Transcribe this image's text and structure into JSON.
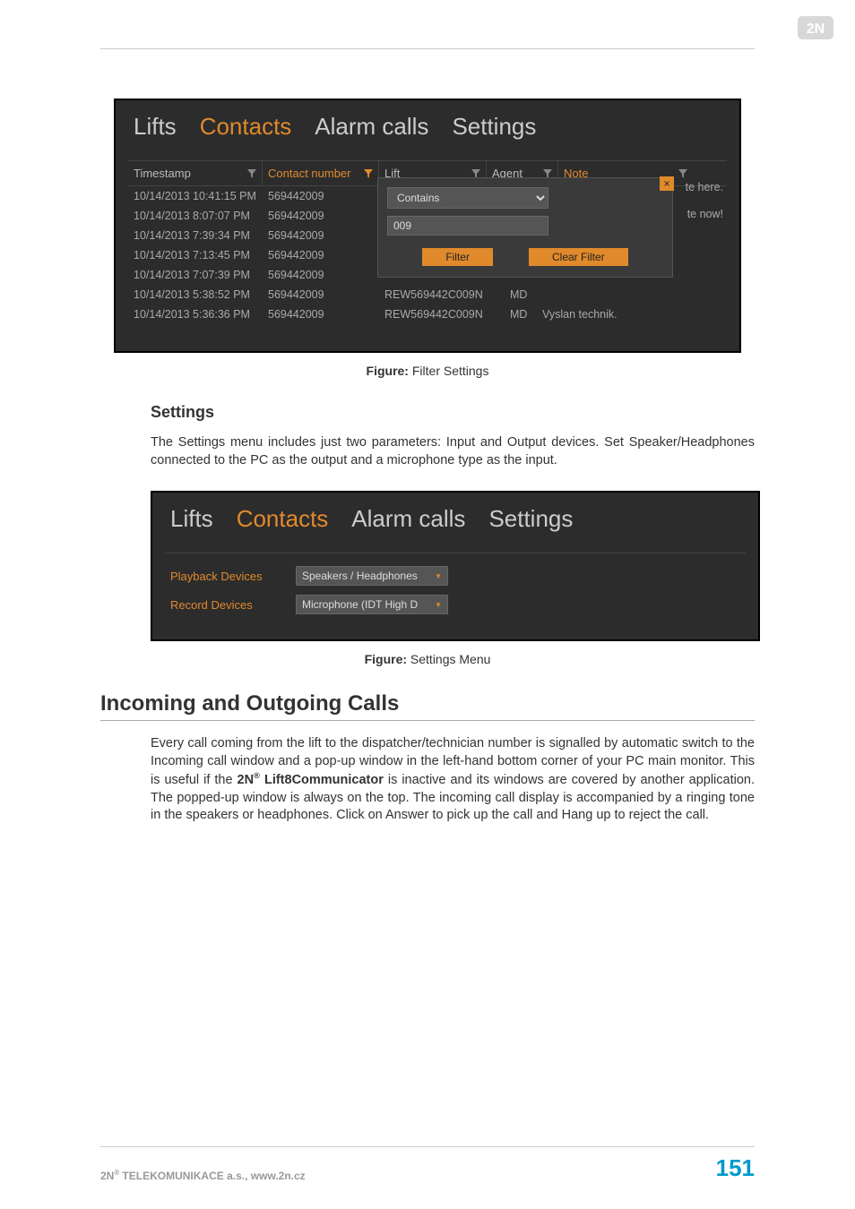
{
  "logo_text": "2N",
  "shot1": {
    "tabs": [
      "Lifts",
      "Contacts",
      "Alarm calls",
      "Settings"
    ],
    "active_tab_index": 1,
    "columns": {
      "timestamp": "Timestamp",
      "contact_number": "Contact number",
      "lift": "Lift",
      "agent": "Agent",
      "note": "Note"
    },
    "rows": [
      {
        "ts": "10/14/2013 10:41:15 PM",
        "cn": "569442009",
        "lift": "",
        "agent": "",
        "note": ""
      },
      {
        "ts": "10/14/2013 8:07:07 PM",
        "cn": "569442009",
        "lift": "",
        "agent": "",
        "note": ""
      },
      {
        "ts": "10/14/2013 7:39:34 PM",
        "cn": "569442009",
        "lift": "",
        "agent": "",
        "note": ""
      },
      {
        "ts": "10/14/2013 7:13:45 PM",
        "cn": "569442009",
        "lift": "",
        "agent": "",
        "note": ""
      },
      {
        "ts": "10/14/2013 7:07:39 PM",
        "cn": "569442009",
        "lift": "",
        "agent": "",
        "note": ""
      },
      {
        "ts": "10/14/2013 5:38:52 PM",
        "cn": "569442009",
        "lift": "REW569442C009N",
        "agent": "MD",
        "note": ""
      },
      {
        "ts": "10/14/2013 5:36:36 PM",
        "cn": "569442009",
        "lift": "REW569442C009N",
        "agent": "MD",
        "note": "Vyslan technik."
      }
    ],
    "popup": {
      "operator": "Contains",
      "value": "009",
      "filter_btn": "Filter",
      "clear_btn": "Clear Filter",
      "close": "×"
    },
    "note_peek1": "te here.",
    "note_peek2": "te now!"
  },
  "caption1_label": "Figure:",
  "caption1_text": "Filter Settings",
  "settings_heading": "Settings",
  "settings_para": "The Settings menu includes just two parameters: Input and Output devices. Set Speaker/Headphones connected to the PC as the output and a microphone type as the input.",
  "shot2": {
    "tabs": [
      "Lifts",
      "Contacts",
      "Alarm calls",
      "Settings"
    ],
    "active_tab_index": 1,
    "rows": [
      {
        "label": "Playback Devices",
        "value": "Speakers / Headphones"
      },
      {
        "label": "Record Devices",
        "value": "Microphone (IDT High D"
      }
    ]
  },
  "caption2_label": "Figure:",
  "caption2_text": "Settings Menu",
  "h2": "Incoming and Outgoing Calls",
  "para2_a": "Every call coming from the lift to the dispatcher/technician number is signalled by automatic switch to the Incoming call window and a pop-up window in the left-hand bottom corner of your PC main monitor. This is useful if the ",
  "para2_bold_pre": "2N",
  "para2_bold_sup": "®",
  "para2_bold_post": " Lift8Communicator",
  "para2_b": " is inactive and its windows are covered by another application. The popped-up window is always on the top. The incoming call display is accompanied by a ringing tone in the speakers or headphones. Click on Answer to pick up the call and Hang up to reject the call.",
  "footer_left_pre": "2N",
  "footer_left_sup": "®",
  "footer_left_post": " TELEKOMUNIKACE a.s., www.2n.cz",
  "page_no": "151"
}
